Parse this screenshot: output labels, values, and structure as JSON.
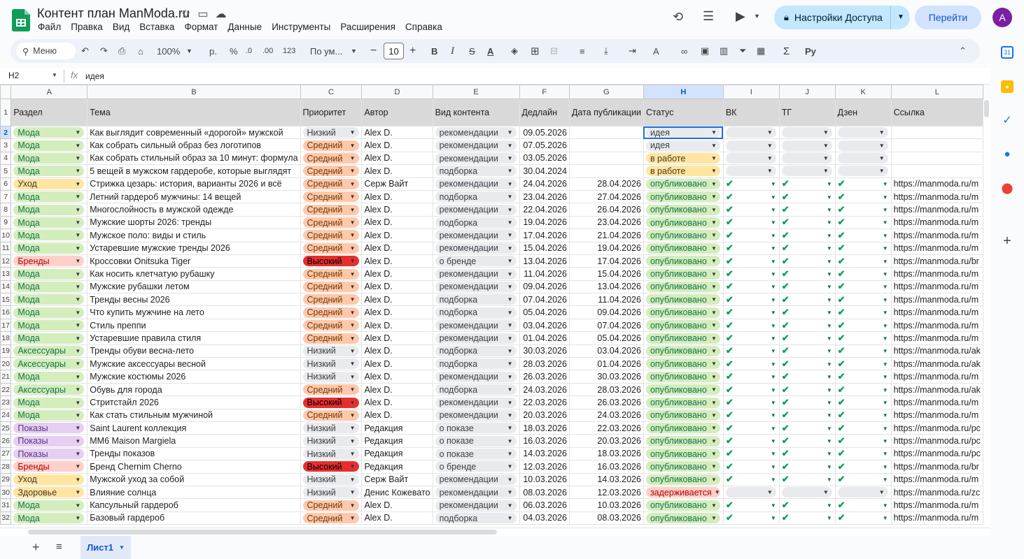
{
  "doc": {
    "title": "Контент план ManModa.ru"
  },
  "menu": [
    "Файл",
    "Правка",
    "Вид",
    "Вставка",
    "Формат",
    "Данные",
    "Инструменты",
    "Расширения",
    "Справка"
  ],
  "header_buttons": {
    "share": "Настройки Доступа",
    "goto": "Перейти",
    "avatar": "A"
  },
  "toolbar": {
    "search": "Меню",
    "zoom": "100%",
    "currency": "р.",
    "percent": "%",
    "dec_less": ".0",
    "dec_more": ".00",
    "format123": "123",
    "font": "По ум...",
    "font_size": "10"
  },
  "formula_bar": {
    "cell": "H2",
    "fx": "fx",
    "value": "идея"
  },
  "columns": [
    "A",
    "B",
    "C",
    "D",
    "E",
    "F",
    "G",
    "H",
    "I",
    "J",
    "K",
    "L"
  ],
  "selected_column": "H",
  "selected_row": 2,
  "header_row": {
    "row": "1",
    "cells": [
      "Раздел",
      "Тема",
      "Приоритет",
      "Автор",
      "Вид контента",
      "Дедлайн",
      "Дата публикации",
      "Статус",
      "ВК",
      "ТГ",
      "Дзен",
      "Ссылка"
    ]
  },
  "rows": [
    {
      "n": "2",
      "section": "Мода",
      "topic": "Как выглядит современный «дорогой» мужской",
      "priority": "Низкий",
      "author": "Alex D.",
      "type": "рекомендации",
      "deadline": "09.05.2026",
      "published": "",
      "status": "идея",
      "vk": "",
      "tg": "",
      "dzen": "",
      "link": ""
    },
    {
      "n": "3",
      "section": "Мода",
      "topic": "Как собрать сильный образ без логотипов",
      "priority": "Средний",
      "author": "Alex D.",
      "type": "рекомендации",
      "deadline": "07.05.2026",
      "published": "",
      "status": "идея",
      "vk": "",
      "tg": "",
      "dzen": "",
      "link": ""
    },
    {
      "n": "4",
      "section": "Мода",
      "topic": "Как собрать стильный образ за 10 минут: формула",
      "priority": "Средний",
      "author": "Alex D.",
      "type": "рекомендации",
      "deadline": "03.05.2026",
      "published": "",
      "status": "в работе",
      "vk": "",
      "tg": "",
      "dzen": "",
      "link": ""
    },
    {
      "n": "5",
      "section": "Мода",
      "topic": "5 вещей в мужском гардеробе, которые выглядят",
      "priority": "Средний",
      "author": "Alex D.",
      "type": "подборка",
      "deadline": "30.04.2024",
      "published": "",
      "status": "в работе",
      "vk": "",
      "tg": "",
      "dzen": "",
      "link": ""
    },
    {
      "n": "6",
      "section": "Уход",
      "topic": "Стрижка цезарь: история, варианты 2026 и всё",
      "priority": "Средний",
      "author": "Серж Вайт",
      "type": "рекомендации",
      "deadline": "24.04.2026",
      "published": "28.04.2026",
      "status": "опубликовано",
      "vk": "✔",
      "tg": "✔",
      "dzen": "✔",
      "link": "https://manmoda.ru/m"
    },
    {
      "n": "7",
      "section": "Мода",
      "topic": "Летний гардероб мужчины: 14 вещей",
      "priority": "Средний",
      "author": "Alex D.",
      "type": "подборка",
      "deadline": "23.04.2026",
      "published": "27.04.2026",
      "status": "опубликовано",
      "vk": "✔",
      "tg": "✔",
      "dzen": "✔",
      "link": "https://manmoda.ru/m"
    },
    {
      "n": "8",
      "section": "Мода",
      "topic": "Многослойность в мужской одежде",
      "priority": "Средний",
      "author": "Alex D.",
      "type": "рекомендации",
      "deadline": "22.04.2026",
      "published": "26.04.2026",
      "status": "опубликовано",
      "vk": "✔",
      "tg": "✔",
      "dzen": "✔",
      "link": "https://manmoda.ru/m"
    },
    {
      "n": "9",
      "section": "Мода",
      "topic": "Мужские шорты 2026: тренды",
      "priority": "Средний",
      "author": "Alex D.",
      "type": "подборка",
      "deadline": "19.04.2026",
      "published": "23.04.2026",
      "status": "опубликовано",
      "vk": "✔",
      "tg": "✔",
      "dzen": "✔",
      "link": "https://manmoda.ru/m"
    },
    {
      "n": "10",
      "section": "Мода",
      "topic": "Мужское поло: виды и стиль",
      "priority": "Средний",
      "author": "Alex D.",
      "type": "рекомендации",
      "deadline": "17.04.2026",
      "published": "21.04.2026",
      "status": "опубликовано",
      "vk": "✔",
      "tg": "✔",
      "dzen": "✔",
      "link": "https://manmoda.ru/m"
    },
    {
      "n": "11",
      "section": "Мода",
      "topic": "Устаревшие мужские тренды 2026",
      "priority": "Средний",
      "author": "Alex D.",
      "type": "рекомендации",
      "deadline": "15.04.2026",
      "published": "19.04.2026",
      "status": "опубликовано",
      "vk": "✔",
      "tg": "✔",
      "dzen": "✔",
      "link": "https://manmoda.ru/m"
    },
    {
      "n": "12",
      "section": "Бренды",
      "topic": "Кроссовки Onitsuka Tiger",
      "priority": "Высокий",
      "author": "Alex D.",
      "type": "о бренде",
      "deadline": "13.04.2026",
      "published": "17.04.2026",
      "status": "опубликовано",
      "vk": "✔",
      "tg": "✔",
      "dzen": "✔",
      "link": "https://manmoda.ru/br"
    },
    {
      "n": "13",
      "section": "Мода",
      "topic": "Как носить клетчатую рубашку",
      "priority": "Средний",
      "author": "Alex D.",
      "type": "рекомендации",
      "deadline": "11.04.2026",
      "published": "15.04.2026",
      "status": "опубликовано",
      "vk": "✔",
      "tg": "✔",
      "dzen": "✔",
      "link": "https://manmoda.ru/m"
    },
    {
      "n": "14",
      "section": "Мода",
      "topic": "Мужские рубашки летом",
      "priority": "Средний",
      "author": "Alex D.",
      "type": "рекомендации",
      "deadline": "09.04.2026",
      "published": "13.04.2026",
      "status": "опубликовано",
      "vk": "✔",
      "tg": "✔",
      "dzen": "✔",
      "link": "https://manmoda.ru/m"
    },
    {
      "n": "15",
      "section": "Мода",
      "topic": "Тренды весны 2026",
      "priority": "Средний",
      "author": "Alex D.",
      "type": "подборка",
      "deadline": "07.04.2026",
      "published": "11.04.2026",
      "status": "опубликовано",
      "vk": "✔",
      "tg": "✔",
      "dzen": "✔",
      "link": "https://manmoda.ru/m"
    },
    {
      "n": "16",
      "section": "Мода",
      "topic": "Что купить мужчине на лето",
      "priority": "Средний",
      "author": "Alex D.",
      "type": "подборка",
      "deadline": "05.04.2026",
      "published": "09.04.2026",
      "status": "опубликовано",
      "vk": "✔",
      "tg": "✔",
      "dzen": "✔",
      "link": "https://manmoda.ru/m"
    },
    {
      "n": "17",
      "section": "Мода",
      "topic": "Стиль преппи",
      "priority": "Средний",
      "author": "Alex D.",
      "type": "рекомендации",
      "deadline": "03.04.2026",
      "published": "07.04.2026",
      "status": "опубликовано",
      "vk": "✔",
      "tg": "✔",
      "dzen": "✔",
      "link": "https://manmoda.ru/m"
    },
    {
      "n": "18",
      "section": "Мода",
      "topic": "Устаревшие правила стиля",
      "priority": "Средний",
      "author": "Alex D.",
      "type": "рекомендации",
      "deadline": "01.04.2026",
      "published": "05.04.2026",
      "status": "опубликовано",
      "vk": "✔",
      "tg": "✔",
      "dzen": "✔",
      "link": "https://manmoda.ru/m"
    },
    {
      "n": "19",
      "section": "Аксессуары",
      "topic": "Тренды обуви весна-лето",
      "priority": "Низкий",
      "author": "Alex D.",
      "type": "подборка",
      "deadline": "30.03.2026",
      "published": "03.04.2026",
      "status": "опубликовано",
      "vk": "✔",
      "tg": "✔",
      "dzen": "✔",
      "link": "https://manmoda.ru/ak"
    },
    {
      "n": "20",
      "section": "Аксессуары",
      "topic": "Мужские аксессуары весной",
      "priority": "Низкий",
      "author": "Alex D.",
      "type": "подборка",
      "deadline": "28.03.2026",
      "published": "01.04.2026",
      "status": "опубликовано",
      "vk": "✔",
      "tg": "✔",
      "dzen": "✔",
      "link": "https://manmoda.ru/ak"
    },
    {
      "n": "21",
      "section": "Мода",
      "topic": "Мужские костюмы 2026",
      "priority": "Низкий",
      "author": "Alex D.",
      "type": "рекомендации",
      "deadline": "26.03.2026",
      "published": "30.03.2026",
      "status": "опубликовано",
      "vk": "✔",
      "tg": "✔",
      "dzen": "✔",
      "link": "https://manmoda.ru/m"
    },
    {
      "n": "22",
      "section": "Аксессуары",
      "topic": "Обувь для города",
      "priority": "Средний",
      "author": "Alex D.",
      "type": "подборка",
      "deadline": "24.03.2026",
      "published": "28.03.2026",
      "status": "опубликовано",
      "vk": "✔",
      "tg": "✔",
      "dzen": "✔",
      "link": "https://manmoda.ru/ak"
    },
    {
      "n": "23",
      "section": "Мода",
      "topic": "Стритстайл 2026",
      "priority": "Высокий",
      "author": "Alex D.",
      "type": "рекомендации",
      "deadline": "22.03.2026",
      "published": "26.03.2026",
      "status": "опубликовано",
      "vk": "✔",
      "tg": "✔",
      "dzen": "✔",
      "link": "https://manmoda.ru/m"
    },
    {
      "n": "24",
      "section": "Мода",
      "topic": "Как стать стильным мужчиной",
      "priority": "Средний",
      "author": "Alex D.",
      "type": "рекомендации",
      "deadline": "20.03.2026",
      "published": "24.03.2026",
      "status": "опубликовано",
      "vk": "✔",
      "tg": "✔",
      "dzen": "✔",
      "link": "https://manmoda.ru/m"
    },
    {
      "n": "25",
      "section": "Показы",
      "topic": "Saint Laurent коллекция",
      "priority": "Низкий",
      "author": "Редакция",
      "type": "о показе",
      "deadline": "18.03.2026",
      "published": "22.03.2026",
      "status": "опубликовано",
      "vk": "✔",
      "tg": "✔",
      "dzen": "✔",
      "link": "https://manmoda.ru/pc"
    },
    {
      "n": "26",
      "section": "Показы",
      "topic": "MM6 Maison Margiela",
      "priority": "Низкий",
      "author": "Редакция",
      "type": "о показе",
      "deadline": "16.03.2026",
      "published": "20.03.2026",
      "status": "опубликовано",
      "vk": "✔",
      "tg": "✔",
      "dzen": "✔",
      "link": "https://manmoda.ru/pc"
    },
    {
      "n": "27",
      "section": "Показы",
      "topic": "Тренды показов",
      "priority": "Низкий",
      "author": "Редакция",
      "type": "о показе",
      "deadline": "14.03.2026",
      "published": "18.03.2026",
      "status": "опубликовано",
      "vk": "✔",
      "tg": "✔",
      "dzen": "✔",
      "link": "https://manmoda.ru/pc"
    },
    {
      "n": "28",
      "section": "Бренды",
      "topic": "Бренд Chernim Cherno",
      "priority": "Высокий",
      "author": "Редакция",
      "type": "о бренде",
      "deadline": "12.03.2026",
      "published": "16.03.2026",
      "status": "опубликовано",
      "vk": "✔",
      "tg": "✔",
      "dzen": "✔",
      "link": "https://manmoda.ru/br"
    },
    {
      "n": "29",
      "section": "Уход",
      "topic": "Мужской уход за собой",
      "priority": "Низкий",
      "author": "Серж Вайт",
      "type": "рекомендации",
      "deadline": "10.03.2026",
      "published": "14.03.2026",
      "status": "опубликовано",
      "vk": "✔",
      "tg": "✔",
      "dzen": "✔",
      "link": "https://manmoda.ru/m"
    },
    {
      "n": "30",
      "section": "Здоровье",
      "topic": "Влияние солнца",
      "priority": "Низкий",
      "author": "Денис Кожевато",
      "type": "рекомендации",
      "deadline": "08.03.2026",
      "published": "12.03.2026",
      "status": "задерживается",
      "vk": "",
      "tg": "",
      "dzen": "",
      "link": "https://manmoda.ru/zc"
    },
    {
      "n": "31",
      "section": "Мода",
      "topic": "Капсульный гардероб",
      "priority": "Средний",
      "author": "Alex D.",
      "type": "рекомендации",
      "deadline": "06.03.2026",
      "published": "10.03.2026",
      "status": "опубликовано",
      "vk": "✔",
      "tg": "✔",
      "dzen": "✔",
      "link": "https://manmoda.ru/m"
    },
    {
      "n": "32",
      "section": "Мода",
      "topic": "Базовый гардероб",
      "priority": "Средний",
      "author": "Alex D.",
      "type": "подборка",
      "deadline": "04.03.2026",
      "published": "08.03.2026",
      "status": "опубликовано",
      "vk": "✔",
      "tg": "✔",
      "dzen": "✔",
      "link": "https://manmoda.ru/m"
    }
  ],
  "sheet_tab": "Лист1",
  "colors": {
    "accent": "#0b57d0",
    "share_bg": "#c2e7ff",
    "header_row_bg": "#d9d9d9",
    "check": "#0f9d58"
  },
  "icons": [
    "sheets-logo-icon",
    "star-icon",
    "move-folder-icon",
    "cloud-icon",
    "history-icon",
    "comment-icon",
    "meet-icon",
    "lock-icon",
    "undo-icon",
    "redo-icon",
    "print-icon",
    "paint-format-icon",
    "bold-icon",
    "italic-icon",
    "strikethrough-icon",
    "text-color-icon",
    "fill-color-icon",
    "borders-icon",
    "merge-icon",
    "align-icon",
    "link-icon",
    "filter-icon",
    "functions-icon",
    "calendar-icon",
    "keep-icon",
    "tasks-icon",
    "contacts-icon",
    "maps-icon",
    "add-icon"
  ]
}
